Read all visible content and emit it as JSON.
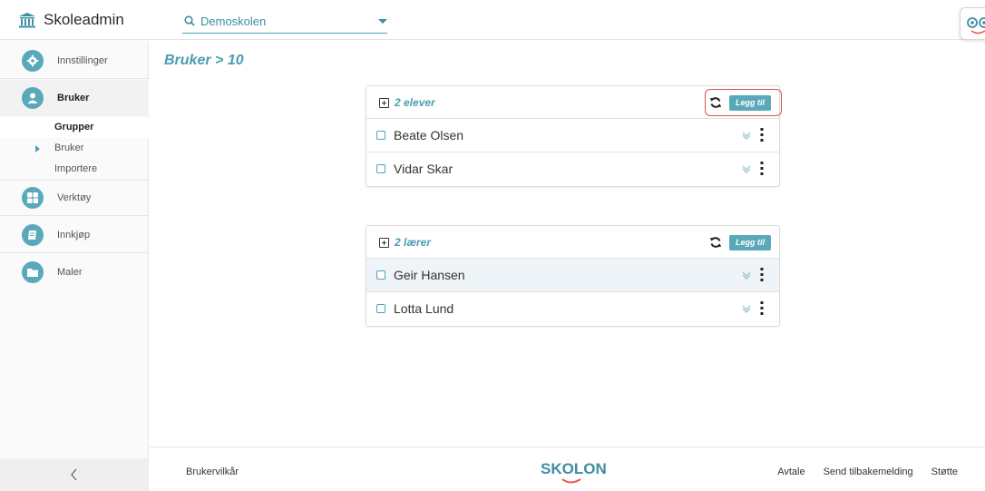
{
  "header": {
    "app_title": "Skoleadmin",
    "school_select": {
      "value": "Demoskolen"
    }
  },
  "sidebar": {
    "items": [
      {
        "label": "Innstillinger",
        "icon": "gear-icon"
      },
      {
        "label": "Bruker",
        "icon": "user-icon"
      },
      {
        "label": "Verktøy",
        "icon": "grid-icon"
      },
      {
        "label": "Innkjøp",
        "icon": "book-icon"
      },
      {
        "label": "Maler",
        "icon": "folder-icon"
      }
    ],
    "subitems": [
      {
        "label": "Grupper"
      },
      {
        "label": "Bruker"
      },
      {
        "label": "Importere"
      }
    ]
  },
  "main": {
    "breadcrumb": "Bruker > 10",
    "groups": [
      {
        "title": "2 elever",
        "add_label": "Legg til",
        "members": [
          "Beate Olsen",
          "Vidar Skar"
        ]
      },
      {
        "title": "2 lærer",
        "add_label": "Legg til",
        "members": [
          "Geir Hansen",
          "Lotta Lund"
        ]
      }
    ]
  },
  "footer": {
    "terms": "Brukervilkår",
    "brand": "SKOLON",
    "links": [
      "Avtale",
      "Send tilbakemelding",
      "Støtte"
    ]
  },
  "colors": {
    "accent": "#4a9db0",
    "button": "#5aa9ba",
    "highlight": "#d9534f"
  }
}
